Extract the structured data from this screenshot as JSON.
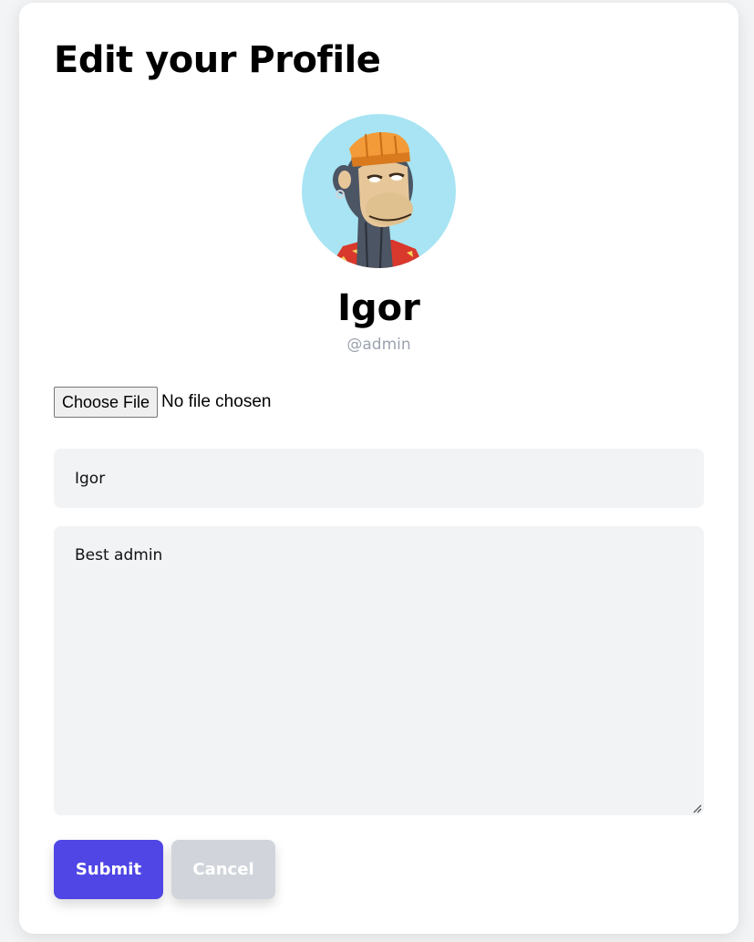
{
  "page": {
    "title": "Edit your Profile"
  },
  "profile": {
    "display_name": "Igor",
    "handle": "@admin",
    "avatar_icon": "bored-ape-avatar"
  },
  "file_input": {
    "button_label": "Choose File",
    "status": "No file chosen"
  },
  "form": {
    "name_value": "Igor",
    "bio_value": "Best admin"
  },
  "actions": {
    "submit_label": "Submit",
    "cancel_label": "Cancel"
  },
  "colors": {
    "accent": "#4f46e5",
    "cancel_bg": "#d1d5db",
    "input_bg": "#f2f3f5",
    "avatar_bg": "#a8e4f3",
    "handle_text": "#9ca3af"
  }
}
